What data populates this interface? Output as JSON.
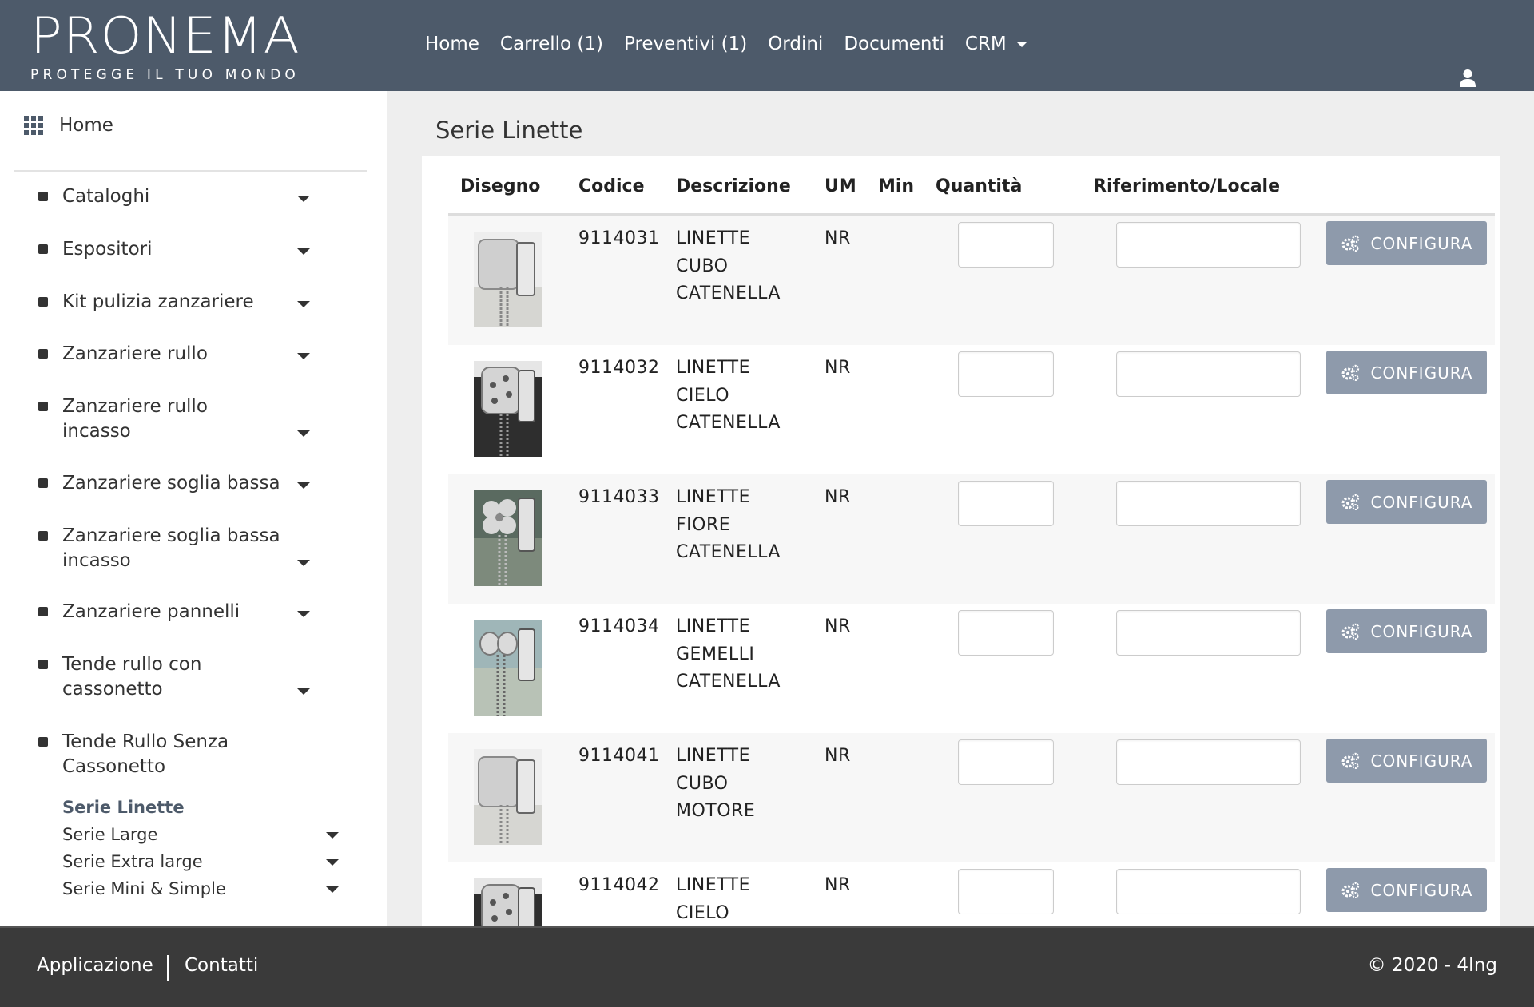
{
  "brand": {
    "name": "PRONEMA",
    "tagline": "PROTEGGE IL TUO MONDO"
  },
  "nav": [
    {
      "label": "Home"
    },
    {
      "label": "Carrello (1)"
    },
    {
      "label": "Preventivi (1)"
    },
    {
      "label": "Ordini"
    },
    {
      "label": "Documenti"
    },
    {
      "label": "CRM"
    }
  ],
  "sidebar": {
    "home": "Home",
    "items": [
      {
        "label": "Cataloghi"
      },
      {
        "label": "Espositori"
      },
      {
        "label": "Kit pulizia zanzariere"
      },
      {
        "label": "Zanzariere rullo"
      },
      {
        "label": "Zanzariere rullo incasso"
      },
      {
        "label": "Zanzariere soglia bassa"
      },
      {
        "label": "Zanzariere soglia bassa incasso"
      },
      {
        "label": "Zanzariere pannelli"
      },
      {
        "label": "Tende rullo con cassonetto"
      },
      {
        "label": "Tende Rullo Senza Cassonetto"
      }
    ],
    "subitems": [
      {
        "label": "Serie Linette"
      },
      {
        "label": "Serie Large"
      },
      {
        "label": "Serie Extra large"
      },
      {
        "label": "Serie Mini & Simple"
      }
    ]
  },
  "main": {
    "title": "Serie Linette",
    "columns": [
      "Disegno",
      "Codice",
      "Descrizione",
      "UM",
      "Min",
      "Quantità",
      "Riferimento/Locale"
    ],
    "configure_label": "CONFIGURA",
    "rows": [
      {
        "code": "9114031",
        "desc": [
          "LINETTE",
          "CUBO",
          "CATENELLA"
        ],
        "um": "NR"
      },
      {
        "code": "9114032",
        "desc": [
          "LINETTE",
          "CIELO",
          "CATENELLA"
        ],
        "um": "NR"
      },
      {
        "code": "9114033",
        "desc": [
          "LINETTE",
          "FIORE",
          "CATENELLA"
        ],
        "um": "NR"
      },
      {
        "code": "9114034",
        "desc": [
          "LINETTE",
          "GEMELLI",
          "CATENELLA"
        ],
        "um": "NR"
      },
      {
        "code": "9114041",
        "desc": [
          "LINETTE",
          "CUBO",
          "MOTORE"
        ],
        "um": "NR"
      },
      {
        "code": "9114042",
        "desc": [
          "LINETTE",
          "CIELO",
          ""
        ],
        "um": "NR"
      }
    ]
  },
  "footer": {
    "app": "Applicazione",
    "contacts": "Contatti",
    "copyright": "© 2020 - 4Ing"
  },
  "colors": {
    "header": "#4d5a6a",
    "button": "#8e9aab",
    "footer": "#3a3a3a"
  }
}
